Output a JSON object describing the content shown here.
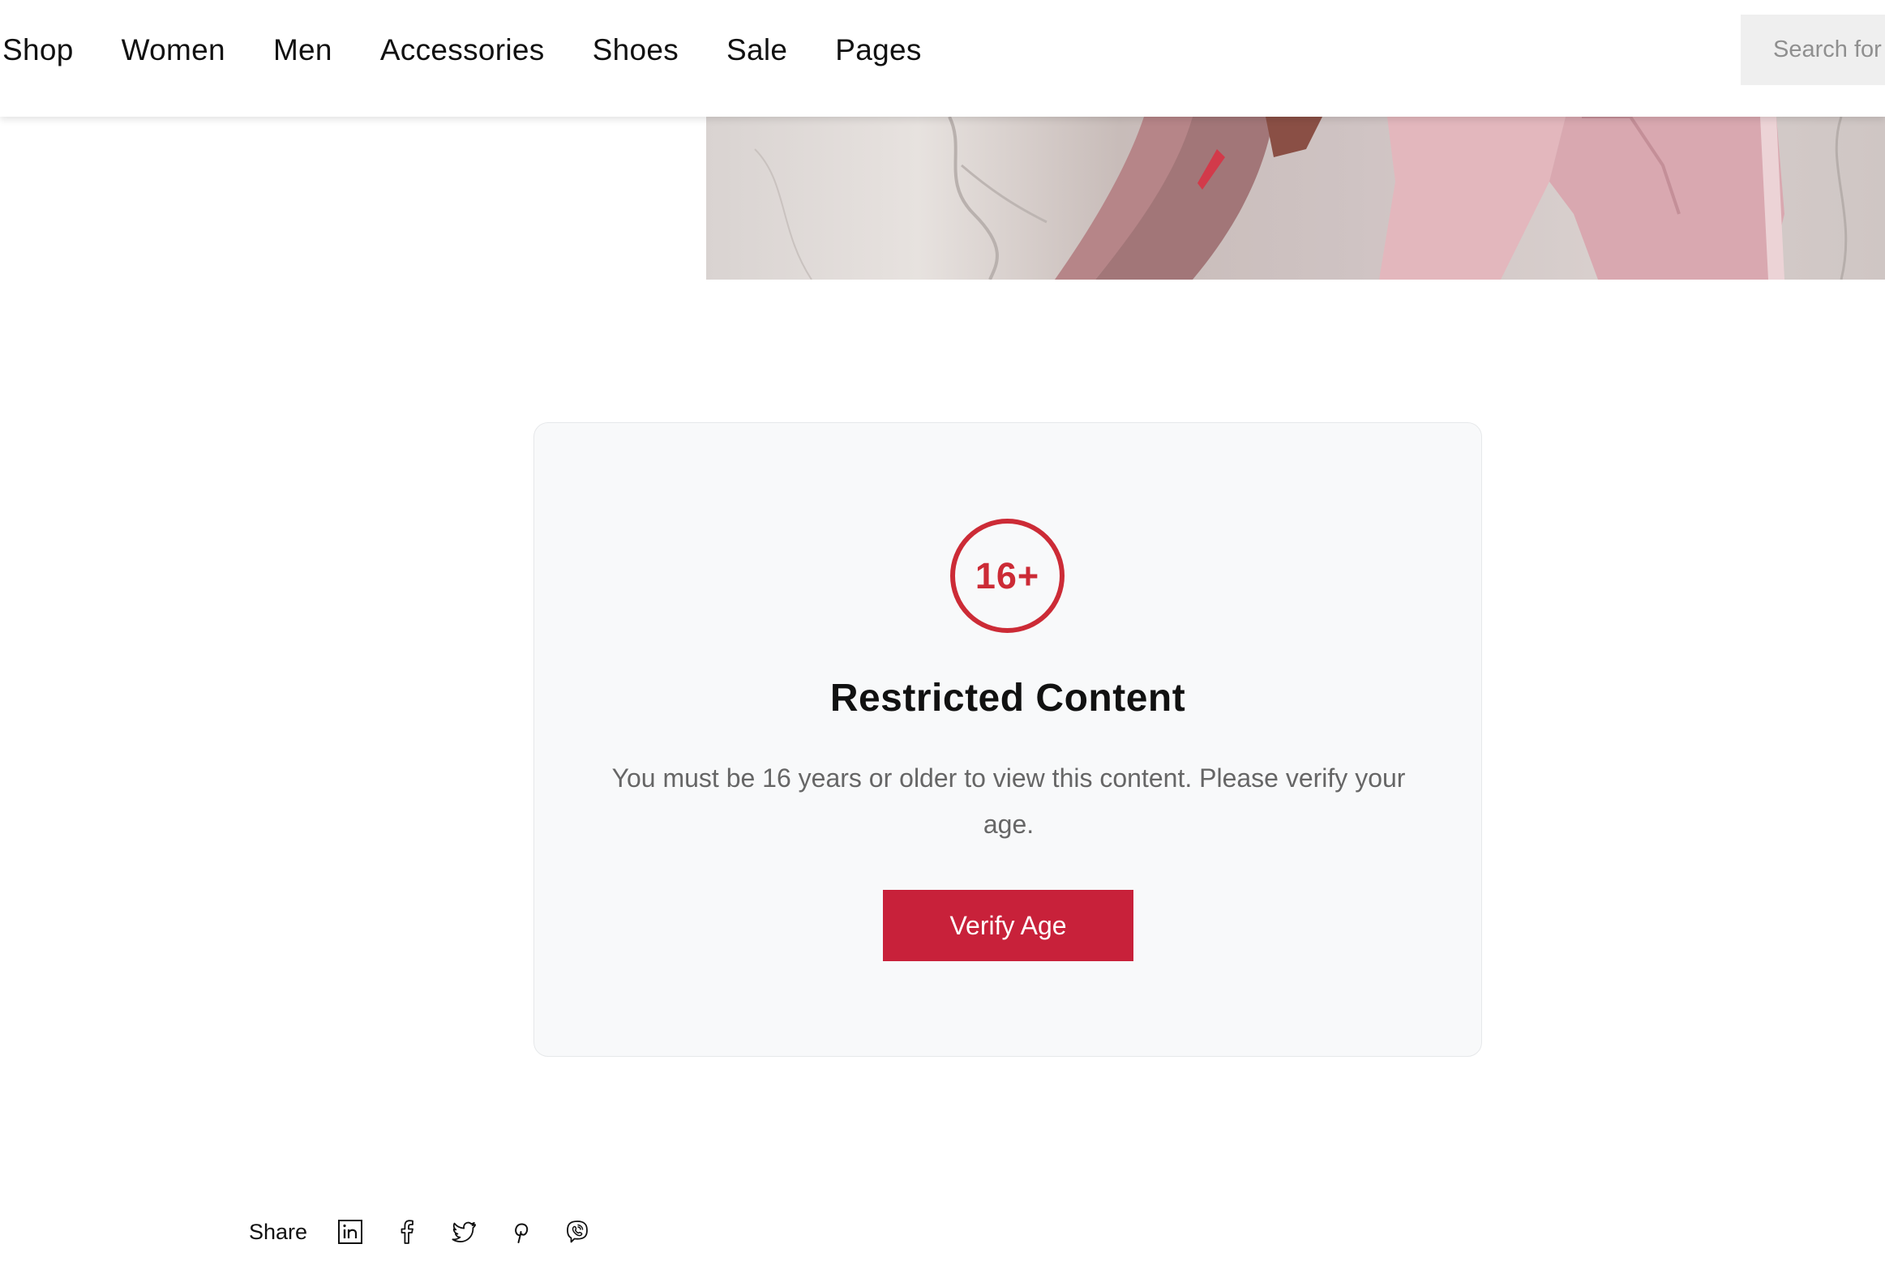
{
  "nav": {
    "items": [
      {
        "label": "Shop"
      },
      {
        "label": "Women"
      },
      {
        "label": "Men"
      },
      {
        "label": "Accessories"
      },
      {
        "label": "Shoes"
      },
      {
        "label": "Sale"
      },
      {
        "label": "Pages"
      }
    ],
    "search_placeholder": "Search for"
  },
  "restricted": {
    "badge": "16+",
    "title": "Restricted Content",
    "message": "You must be 16 years or older to view this content. Please verify your age.",
    "button_label": "Verify Age"
  },
  "share": {
    "label": "Share",
    "icons": [
      "linkedin-icon",
      "facebook-icon",
      "twitter-icon",
      "pinterest-icon",
      "viber-icon"
    ]
  },
  "colors": {
    "accent": "#c8213a",
    "badge_red": "#cc2b36",
    "card_bg": "#f8f9fa",
    "muted_text": "#666666"
  }
}
